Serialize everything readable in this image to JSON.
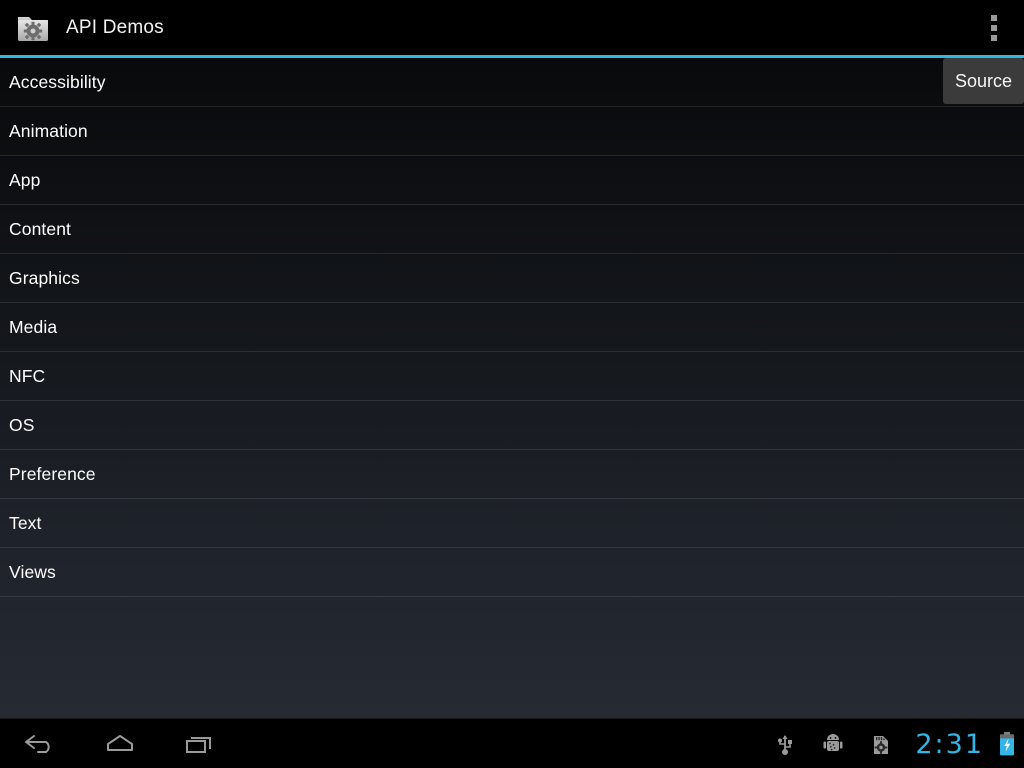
{
  "app": {
    "title": "API Demos",
    "icon": "folder-gear-icon"
  },
  "action_bar": {
    "overflow_label": "overflow-menu-icon",
    "accent_color": "#33b5e5"
  },
  "tooltip": {
    "label": "Source"
  },
  "list": {
    "items": [
      {
        "label": "Accessibility"
      },
      {
        "label": "Animation"
      },
      {
        "label": "App"
      },
      {
        "label": "Content"
      },
      {
        "label": "Graphics"
      },
      {
        "label": "Media"
      },
      {
        "label": "NFC"
      },
      {
        "label": "OS"
      },
      {
        "label": "Preference"
      },
      {
        "label": "Text"
      },
      {
        "label": "Views"
      }
    ]
  },
  "nav_bar": {
    "back": "back-icon",
    "home": "home-icon",
    "recents": "recents-icon"
  },
  "status_bar": {
    "usb": "usb-icon",
    "adb": "android-debug-icon",
    "sdcard": "sdcard-settings-icon",
    "clock": "2:31",
    "battery": "battery-charging-icon",
    "clock_color": "#33b5e5"
  }
}
